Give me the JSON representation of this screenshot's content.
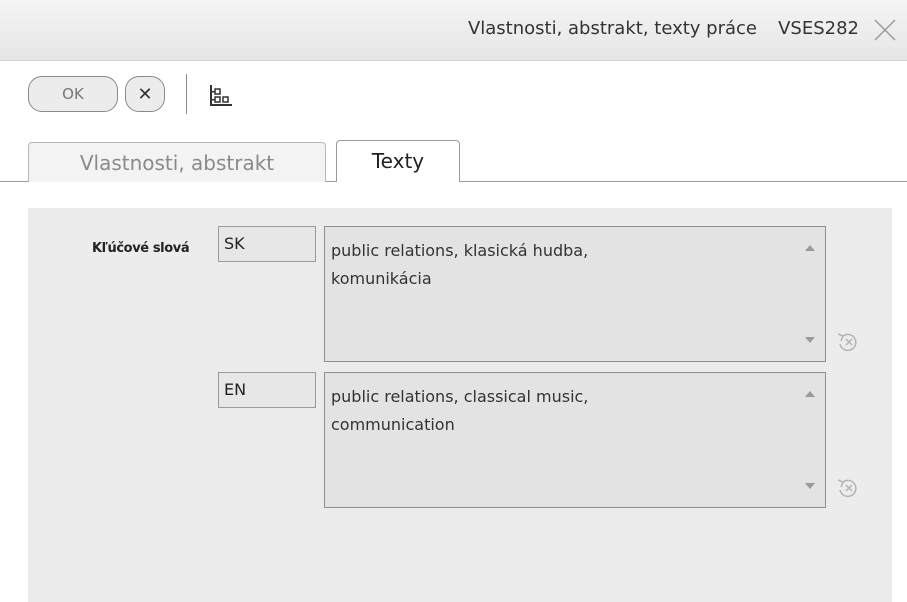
{
  "window": {
    "title": "Vlastnosti, abstrakt, texty práce",
    "code": "VSES282"
  },
  "toolbar": {
    "ok_label": "OK",
    "cancel_label": "✕"
  },
  "tabs": [
    {
      "label": "Vlastnosti, abstrakt",
      "active": false
    },
    {
      "label": "Texty",
      "active": true
    }
  ],
  "keywords": {
    "label": "Kľúčové slová",
    "entries": [
      {
        "lang": "SK",
        "value": "public relations, klasická hudba,\nkomunikácia"
      },
      {
        "lang": "EN",
        "value": "public relations, classical music,\ncommunication"
      }
    ]
  },
  "icons": {
    "close": "close-icon",
    "hierarchy": "hierarchy-icon",
    "reset": "reset-icon",
    "scroll_up": "scroll-up-icon",
    "scroll_down": "scroll-down-icon"
  }
}
